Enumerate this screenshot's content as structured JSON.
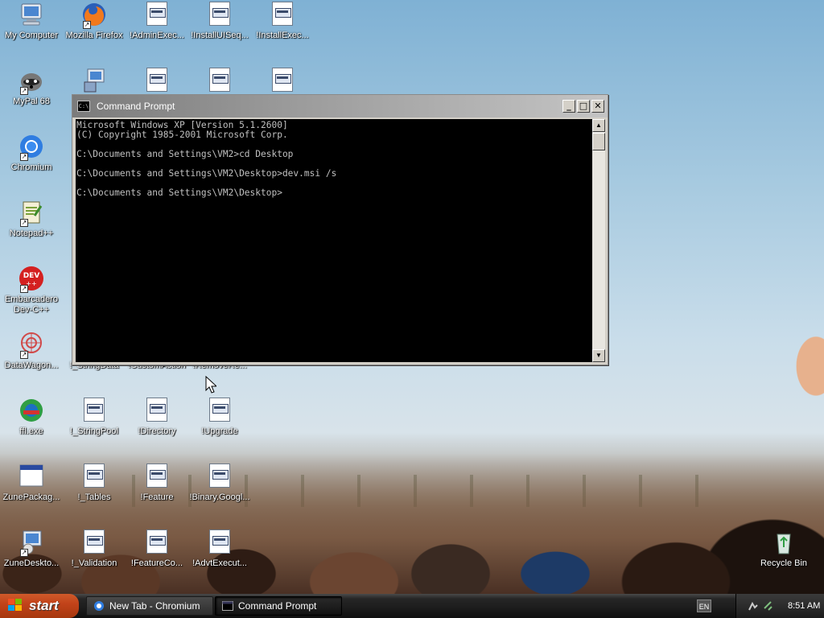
{
  "desktop": {
    "icons": [
      {
        "label": "My Computer"
      },
      {
        "label": "Mozilla Firefox"
      },
      {
        "label": "!AdminExec..."
      },
      {
        "label": "!InstallUISeq..."
      },
      {
        "label": "!InstallExec..."
      },
      {
        "label": "MyPal 68"
      },
      {
        "label": "Chromium"
      },
      {
        "label": "Notepad++"
      },
      {
        "label": "Embarcadero Dev-C++"
      },
      {
        "label": "DataWagon..."
      },
      {
        "label": "!_StringData"
      },
      {
        "label": "!CustomAction"
      },
      {
        "label": "!RemoveRe..."
      },
      {
        "label": "ffl.exe"
      },
      {
        "label": "!_StringPool"
      },
      {
        "label": "!Directory"
      },
      {
        "label": "!Upgrade"
      },
      {
        "label": "ZunePackag..."
      },
      {
        "label": "!_Tables"
      },
      {
        "label": "!Feature"
      },
      {
        "label": "!Binary.Googl..."
      },
      {
        "label": "ZuneDeskto..."
      },
      {
        "label": "!_Validation"
      },
      {
        "label": "!FeatureCo..."
      },
      {
        "label": "!AdvtExecut..."
      },
      {
        "label": "Recycle Bin"
      }
    ]
  },
  "cmd_window": {
    "title": "Command Prompt",
    "title_icon_text": "C:\\",
    "console_text": "Microsoft Windows XP [Version 5.1.2600]\n(C) Copyright 1985-2001 Microsoft Corp.\n\nC:\\Documents and Settings\\VM2>cd Desktop\n\nC:\\Documents and Settings\\VM2\\Desktop>dev.msi /s\n\nC:\\Documents and Settings\\VM2\\Desktop>",
    "minimize_glyph": "_",
    "maximize_glyph": "□",
    "close_glyph": "✕"
  },
  "taskbar": {
    "start_label": "start",
    "tasks": [
      {
        "label": "New Tab - Chromium"
      },
      {
        "label": "Command Prompt"
      }
    ],
    "language": "EN",
    "clock": "8:51 AM"
  },
  "colors": {
    "console_bg": "#000000",
    "console_fg": "#c0c0c0",
    "start_button": "#c2431a"
  }
}
